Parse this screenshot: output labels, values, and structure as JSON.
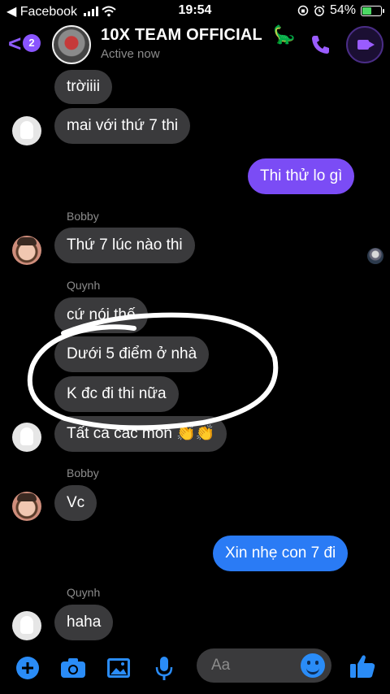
{
  "status_bar": {
    "back_app": "◀ Facebook",
    "time": "19:54",
    "battery_pct": "54%",
    "battery_level": 0.54
  },
  "header": {
    "unread_badge": "2",
    "title": "10X TEAM OFFICIAL",
    "title_emoji": "🦕",
    "subtitle": "Active now"
  },
  "messages": [
    {
      "text": "trờiiii"
    },
    {
      "text": "mai với thứ 7 thi"
    },
    {
      "text": "Thi thử lo gì"
    },
    {
      "sender": "Bobby",
      "text": "Thứ 7 lúc nào thi"
    },
    {
      "sender": "Quynh",
      "text": "cứ nói thế"
    },
    {
      "text": "Dưới 5 điểm ở nhà"
    },
    {
      "text": "K đc đi thi nữa"
    },
    {
      "text": "Tất cả các môn 👏👏"
    },
    {
      "sender": "Bobby",
      "text": "Vc"
    },
    {
      "text": "Xin nhẹ con 7 đi"
    },
    {
      "sender": "Quynh",
      "text": "haha"
    }
  ],
  "composer": {
    "placeholder": "Aa"
  },
  "colors": {
    "accent": "#8a55ff",
    "outgoing_purple": "#7b4cf5",
    "outgoing_blue": "#2a7bf5",
    "incoming": "#3a3a3c"
  }
}
